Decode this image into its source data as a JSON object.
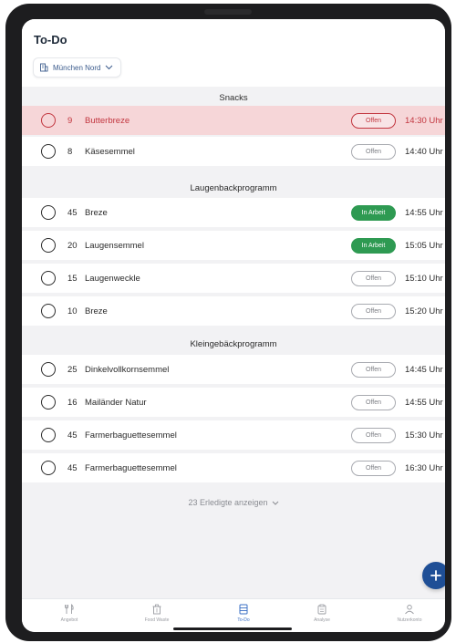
{
  "header": {
    "title": "To-Do",
    "location": "München Nord"
  },
  "sections": [
    {
      "title": "Snacks",
      "rows": [
        {
          "qty": "9",
          "name": "Butterbreze",
          "status": "Offen",
          "time": "14:30 Uhr",
          "highlighted": true
        },
        {
          "qty": "8",
          "name": "Käsesemmel",
          "status": "Offen",
          "time": "14:40 Uhr",
          "highlighted": false
        }
      ]
    },
    {
      "title": "Laugenbackprogramm",
      "rows": [
        {
          "qty": "45",
          "name": "Breze",
          "status": "In Arbeit",
          "time": "14:55 Uhr",
          "highlighted": false
        },
        {
          "qty": "20",
          "name": "Laugensemmel",
          "status": "In Arbeit",
          "time": "15:05 Uhr",
          "highlighted": false
        },
        {
          "qty": "15",
          "name": "Laugenweckle",
          "status": "Offen",
          "time": "15:10 Uhr",
          "highlighted": false
        },
        {
          "qty": "10",
          "name": "Breze",
          "status": "Offen",
          "time": "15:20 Uhr",
          "highlighted": false
        }
      ]
    },
    {
      "title": "Kleingebäckprogramm",
      "rows": [
        {
          "qty": "25",
          "name": "Dinkelvollkornsemmel",
          "status": "Offen",
          "time": "14:45 Uhr",
          "highlighted": false
        },
        {
          "qty": "16",
          "name": "Mailänder Natur",
          "status": "Offen",
          "time": "14:55 Uhr",
          "highlighted": false
        },
        {
          "qty": "45",
          "name": "Farmerbaguettesemmel",
          "status": "Offen",
          "time": "15:30 Uhr",
          "highlighted": false
        },
        {
          "qty": "45",
          "name": "Farmerbaguettesemmel",
          "status": "Offen",
          "time": "16:30 Uhr",
          "highlighted": false
        }
      ]
    }
  ],
  "show_done": "23 Erledigte anzeigen",
  "tabs": [
    {
      "label": "Angebot",
      "icon": "utensils-icon",
      "active": false
    },
    {
      "label": "Food Waste",
      "icon": "trash-icon",
      "active": false
    },
    {
      "label": "To-Do",
      "icon": "list-icon",
      "active": true
    },
    {
      "label": "Analyse",
      "icon": "clipboard-icon",
      "active": false
    },
    {
      "label": "Nutzerkonto",
      "icon": "user-icon",
      "active": false
    }
  ],
  "colors": {
    "accent": "#1f4f96",
    "alert": "#c2363f",
    "alert_bg": "#f6d6d8",
    "in_progress": "#2e9a52"
  }
}
